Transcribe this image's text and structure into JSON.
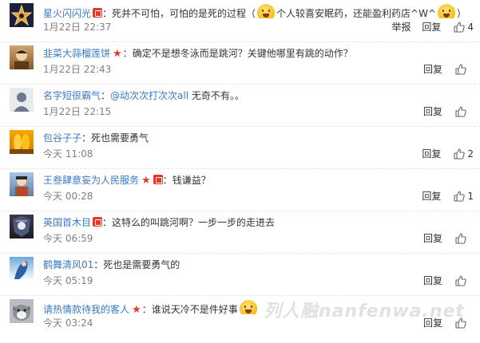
{
  "comments": [
    {
      "user": "星火闪闪光",
      "badges": [
        "red-badge"
      ],
      "text_before": "死并不可怕，可怕的是死的过程（",
      "text_middle": "个人较喜安眠药，还能盈利药店^W^",
      "text_after": "）",
      "time": "1月22日 22:37",
      "report": "举报",
      "reply": "回复",
      "likes": "4"
    },
    {
      "user": "韭菜大蒜榴莲饼",
      "badges": [
        "star"
      ],
      "text": "确定不是想冬泳而是跳河？关键他哪里有跳的动作？",
      "time": "1月22日 22:43",
      "reply": "回复",
      "likes": ""
    },
    {
      "user": "名字短很霸气",
      "badges": [],
      "mention": "@动次次打次次all",
      "text": " 无奇不有。。",
      "time": "1月22日 22:15",
      "reply": "回复",
      "likes": ""
    },
    {
      "user": "包谷子子",
      "badges": [],
      "text": "死也需要勇气",
      "time": "今天 11:08",
      "reply": "回复",
      "likes": "2"
    },
    {
      "user": "王叁肆意妄为人民服务",
      "badges": [
        "star",
        "red-badge"
      ],
      "text": "钱谦益？",
      "time": "今天 00:28",
      "reply": "回复",
      "likes": "1"
    },
    {
      "user": "英国首木目",
      "badges": [
        "red-badge"
      ],
      "text": "这特么的叫跳河啊？一步一步的走进去",
      "time": "今天 06:59",
      "reply": "回复",
      "likes": ""
    },
    {
      "user": "鹤舞清风01",
      "badges": [],
      "text": "死也是需要勇气的",
      "time": "今天 05:19",
      "reply": "回复",
      "likes": ""
    },
    {
      "user": "请热情款待我的客人",
      "badges": [
        "star"
      ],
      "text": "谁说天冷不是件好事",
      "time": "今天 03:24",
      "reply": "回复",
      "likes": ""
    }
  ],
  "watermark": "列人融nanfenwa.net",
  "colors": {
    "link": "#3a78c3",
    "badge": "#e13a2a",
    "time": "#808080"
  },
  "icons": {
    "like": "thumbs-up-icon",
    "emoji": "grin-emoji-icon",
    "badge": "red-envelope-badge-icon",
    "star": "star-icon"
  }
}
